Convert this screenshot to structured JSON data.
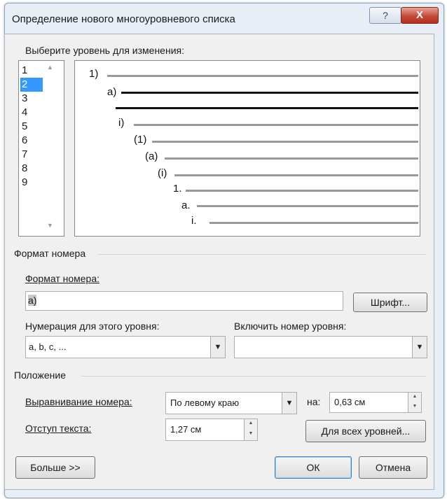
{
  "title": "Определение нового многоуровневого списка",
  "titlebar": {
    "help": "?",
    "close": "X"
  },
  "level_section": {
    "label": "Выберите уровень для изменения:",
    "levels": [
      "1",
      "2",
      "3",
      "4",
      "5",
      "6",
      "7",
      "8",
      "9"
    ],
    "selected_index": 1
  },
  "preview": {
    "numbers": [
      "1)",
      "a)",
      "i)",
      "(1)",
      "(a)",
      "(i)",
      "1.",
      "a.",
      "i."
    ]
  },
  "number_format_group": {
    "title": "Формат номера",
    "format_label": "Формат номера:",
    "format_value": "a)",
    "font_button": "Шрифт...",
    "numbering_label": "Нумерация для этого уровня:",
    "numbering_value": "a, b, c, ...",
    "include_label": "Включить номер уровня:",
    "include_value": ""
  },
  "position_group": {
    "title": "Положение",
    "alignment_label": "Выравнивание номера:",
    "alignment_value": "По левому краю",
    "at_label": "на:",
    "at_value": "0,63 см",
    "indent_label": "Отступ текста:",
    "indent_value": "1,27 см",
    "all_levels_button": "Для всех уровней..."
  },
  "buttons": {
    "more": "Больше >>",
    "ok": "ОК",
    "cancel": "Отмена"
  },
  "colors": {
    "selection": "#3399ff",
    "window_border": "#8fa6c2",
    "close": "#c5493a"
  }
}
